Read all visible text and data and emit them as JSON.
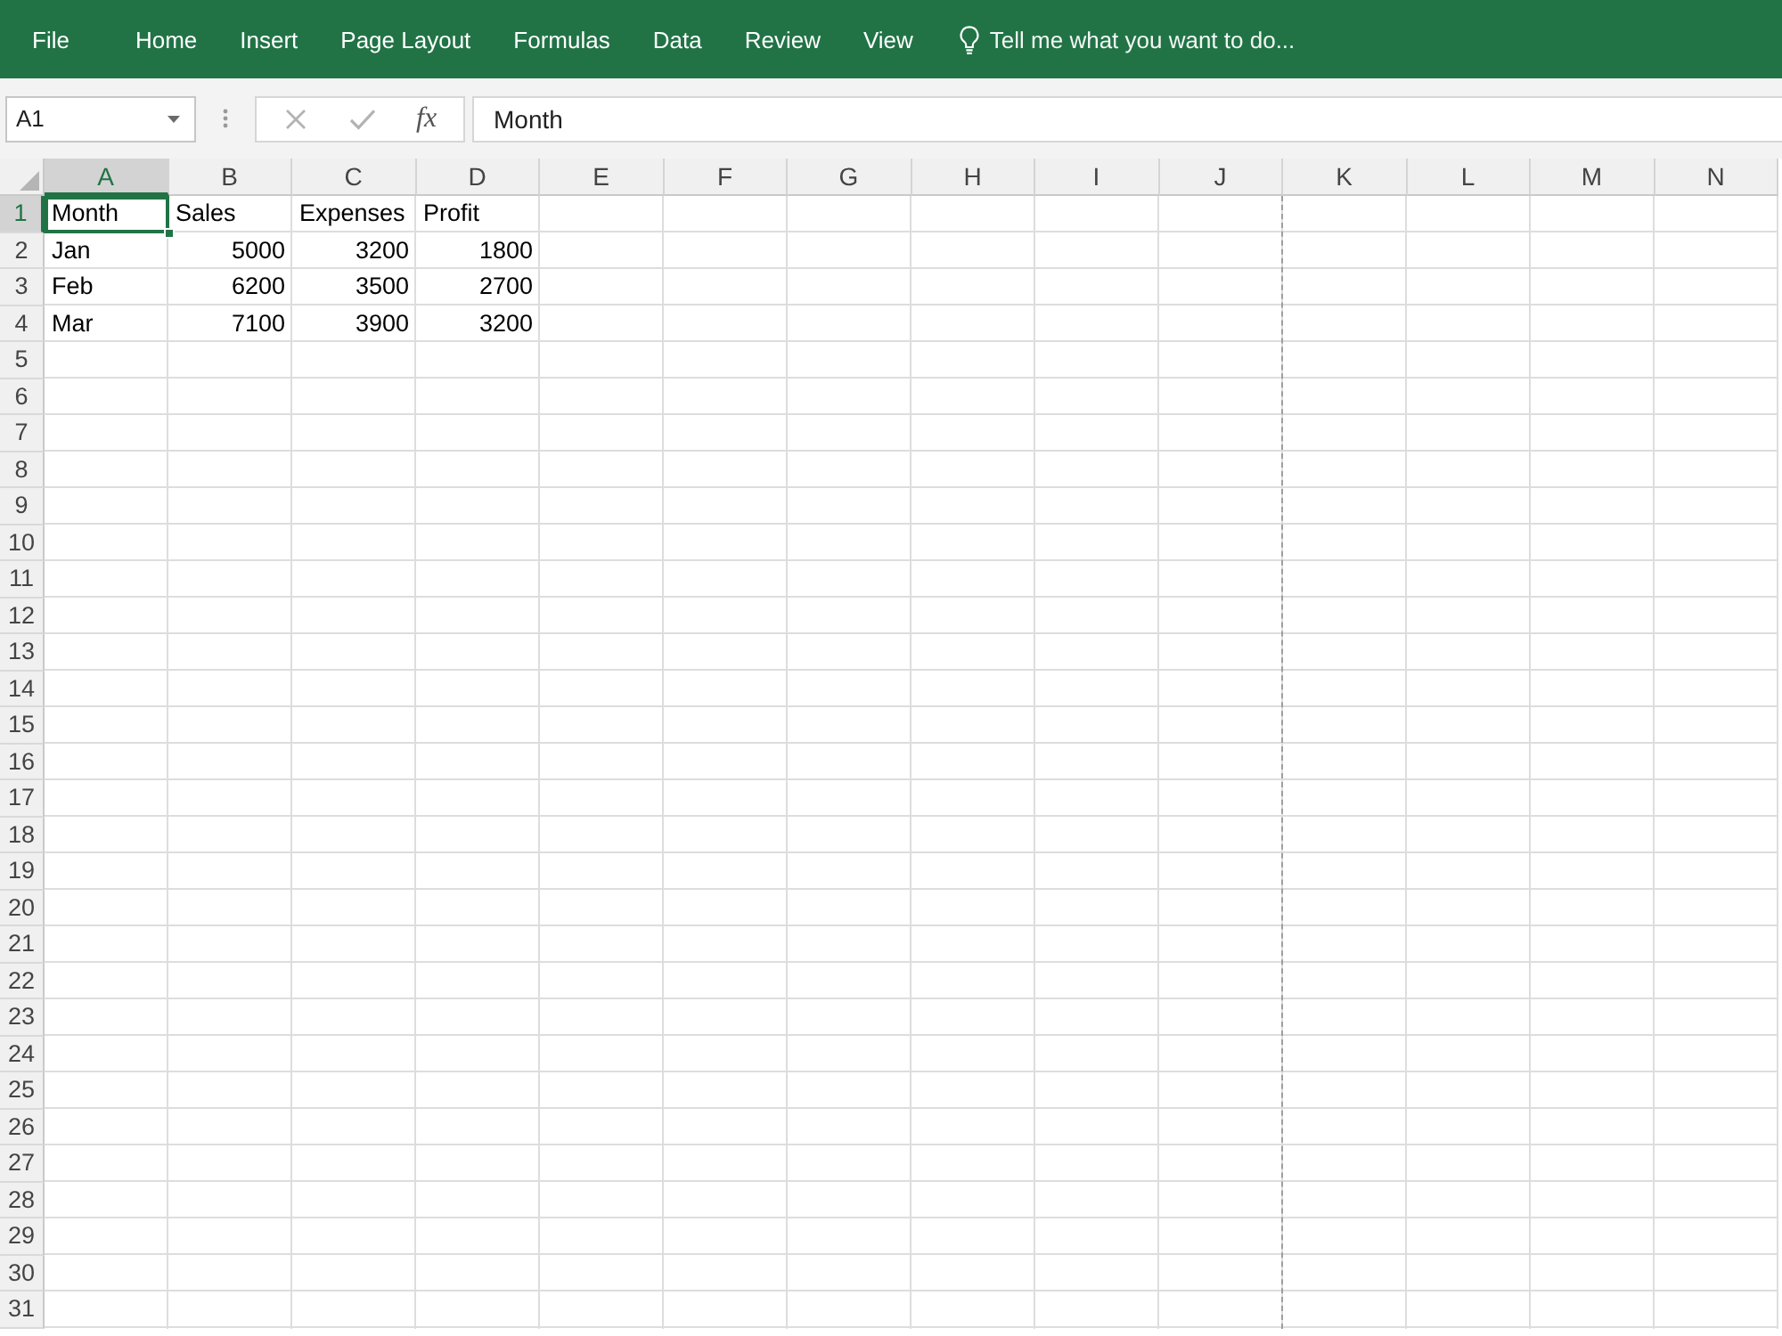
{
  "ribbon": {
    "tabs": [
      {
        "label": "File",
        "selected": false
      },
      {
        "label": "Home",
        "selected": false
      },
      {
        "label": "Insert",
        "selected": false
      },
      {
        "label": "Page Layout",
        "selected": false
      },
      {
        "label": "Formulas",
        "selected": false
      },
      {
        "label": "Data",
        "selected": false
      },
      {
        "label": "Review",
        "selected": false
      },
      {
        "label": "View",
        "selected": false
      }
    ],
    "tell_me": {
      "label": "Tell me what you want to do..."
    }
  },
  "formula_bar": {
    "name_box": {
      "value": "A1"
    },
    "cancel_button": {
      "disabled": true
    },
    "enter_button": {
      "disabled": true
    },
    "insert_function_button": {
      "label": "fx"
    },
    "formula_field": {
      "value": "Month"
    }
  },
  "sheet": {
    "columns": [
      {
        "label": "A",
        "selected": true,
        "page_break_after": false
      },
      {
        "label": "B",
        "selected": false,
        "page_break_after": false
      },
      {
        "label": "C",
        "selected": false,
        "page_break_after": false
      },
      {
        "label": "D",
        "selected": false,
        "page_break_after": false
      },
      {
        "label": "E",
        "selected": false,
        "page_break_after": false
      },
      {
        "label": "F",
        "selected": false,
        "page_break_after": false
      },
      {
        "label": "G",
        "selected": false,
        "page_break_after": false
      },
      {
        "label": "H",
        "selected": false,
        "page_break_after": false
      },
      {
        "label": "I",
        "selected": false,
        "page_break_after": false
      },
      {
        "label": "J",
        "selected": false,
        "page_break_after": true
      },
      {
        "label": "K",
        "selected": false,
        "page_break_after": false
      },
      {
        "label": "L",
        "selected": false,
        "page_break_after": false
      },
      {
        "label": "M",
        "selected": false,
        "page_break_after": false
      },
      {
        "label": "N",
        "selected": false,
        "page_break_after": false
      }
    ],
    "rows": [
      {
        "label": "1",
        "selected": true,
        "cells": [
          {
            "value": "Month",
            "kind": "text",
            "selected": true
          },
          {
            "value": "Sales",
            "kind": "text",
            "selected": false
          },
          {
            "value": "Expenses",
            "kind": "text",
            "selected": false
          },
          {
            "value": "Profit",
            "kind": "text",
            "selected": false
          }
        ]
      },
      {
        "label": "2",
        "selected": false,
        "cells": [
          {
            "value": "Jan",
            "kind": "text",
            "selected": false
          },
          {
            "value": "5000",
            "kind": "number",
            "selected": false
          },
          {
            "value": "3200",
            "kind": "number",
            "selected": false
          },
          {
            "value": "1800",
            "kind": "number",
            "selected": false
          }
        ]
      },
      {
        "label": "3",
        "selected": false,
        "cells": [
          {
            "value": "Feb",
            "kind": "text",
            "selected": false
          },
          {
            "value": "6200",
            "kind": "number",
            "selected": false
          },
          {
            "value": "3500",
            "kind": "number",
            "selected": false
          },
          {
            "value": "2700",
            "kind": "number",
            "selected": false
          }
        ]
      },
      {
        "label": "4",
        "selected": false,
        "cells": [
          {
            "value": "Mar",
            "kind": "text",
            "selected": false
          },
          {
            "value": "7100",
            "kind": "number",
            "selected": false
          },
          {
            "value": "3900",
            "kind": "number",
            "selected": false
          },
          {
            "value": "3200",
            "kind": "number",
            "selected": false
          }
        ]
      },
      {
        "label": "5",
        "selected": false
      },
      {
        "label": "6",
        "selected": false
      },
      {
        "label": "7",
        "selected": false
      },
      {
        "label": "8",
        "selected": false
      },
      {
        "label": "9",
        "selected": false
      },
      {
        "label": "10",
        "selected": false
      },
      {
        "label": "11",
        "selected": false
      },
      {
        "label": "12",
        "selected": false
      },
      {
        "label": "13",
        "selected": false
      },
      {
        "label": "14",
        "selected": false
      },
      {
        "label": "15",
        "selected": false
      },
      {
        "label": "16",
        "selected": false
      },
      {
        "label": "17",
        "selected": false
      },
      {
        "label": "18",
        "selected": false
      },
      {
        "label": "19",
        "selected": false
      },
      {
        "label": "20",
        "selected": false
      },
      {
        "label": "21",
        "selected": false
      },
      {
        "label": "22",
        "selected": false
      },
      {
        "label": "23",
        "selected": false
      },
      {
        "label": "24",
        "selected": false
      },
      {
        "label": "25",
        "selected": false
      },
      {
        "label": "26",
        "selected": false
      },
      {
        "label": "27",
        "selected": false
      },
      {
        "label": "28",
        "selected": false
      },
      {
        "label": "29",
        "selected": false
      },
      {
        "label": "30",
        "selected": false
      },
      {
        "label": "31",
        "selected": false
      }
    ]
  }
}
